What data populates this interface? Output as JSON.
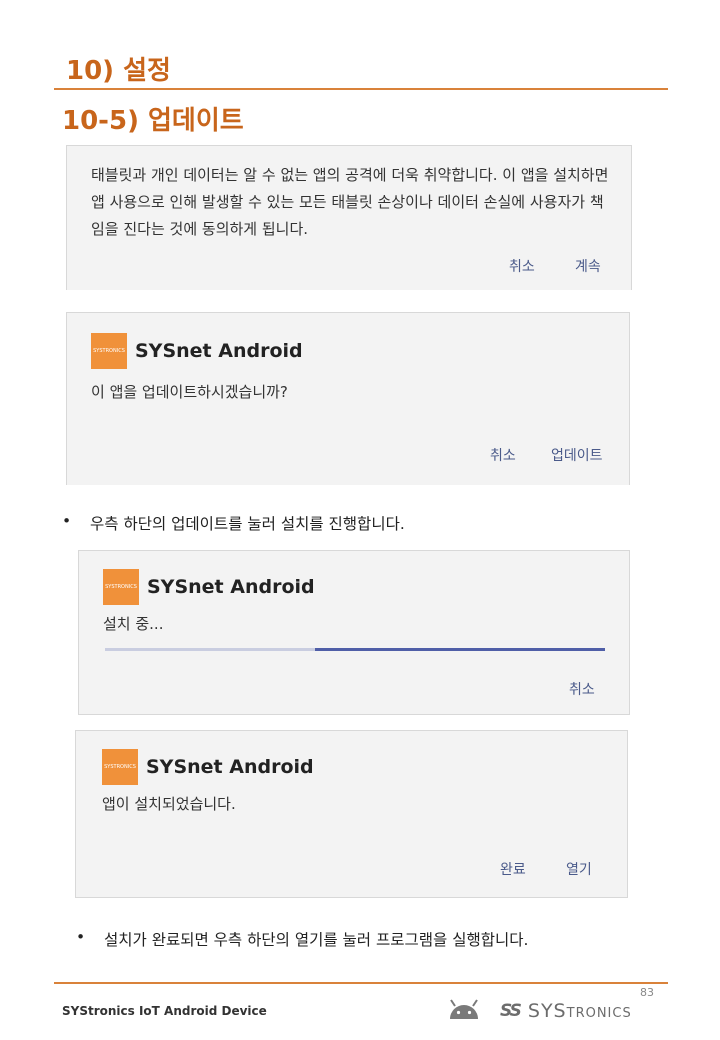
{
  "section_title": "10) 설정",
  "subsection_title": "10-5) 업데이트",
  "dialog1": {
    "message": "태블릿과 개인 데이터는 알 수 없는 앱의 공격에 더욱 취약합니다. 이 앱을 설치하면 앱 사용으로 인해 발생할 수 있는 모든 태블릿 손상이나 데이터 손실에 사용자가 책임을 진다는 것에 동의하게 됩니다.",
    "cancel": "취소",
    "continue": "계속"
  },
  "dialog2": {
    "app_name": "SYSnet Android",
    "icon_text": "SYSTRONICS",
    "message": "이 앱을 업데이트하시겠습니까?",
    "cancel": "취소",
    "update": "업데이트"
  },
  "bullet1": "우측 하단의 업데이트를 눌러 설치를 진행합니다.",
  "dialog3": {
    "app_name": "SYSnet Android",
    "icon_text": "SYSTRONICS",
    "message": "설치 중...",
    "progress": 0.58,
    "cancel": "취소"
  },
  "dialog4": {
    "app_name": "SYSnet Android",
    "icon_text": "SYSTRONICS",
    "message": "앱이 설치되었습니다.",
    "done": "완료",
    "open": "열기"
  },
  "bullet2": "설치가 완료되면 우측 하단의 열기를 눌러 프로그램을 실행합니다.",
  "bullet_symbol": "•",
  "footer": {
    "page_number": "83",
    "doc_title": "SYStronics IoT Android Device",
    "brand_mark": "SS",
    "brand_name_big": "SYS",
    "brand_name_small": "TRONICS"
  },
  "colors": {
    "accent": "#c8651b",
    "rule": "#d9823a",
    "button_text": "#4a5a8a",
    "progress": "#4f5ea7",
    "icon_bg": "#f0913a"
  }
}
